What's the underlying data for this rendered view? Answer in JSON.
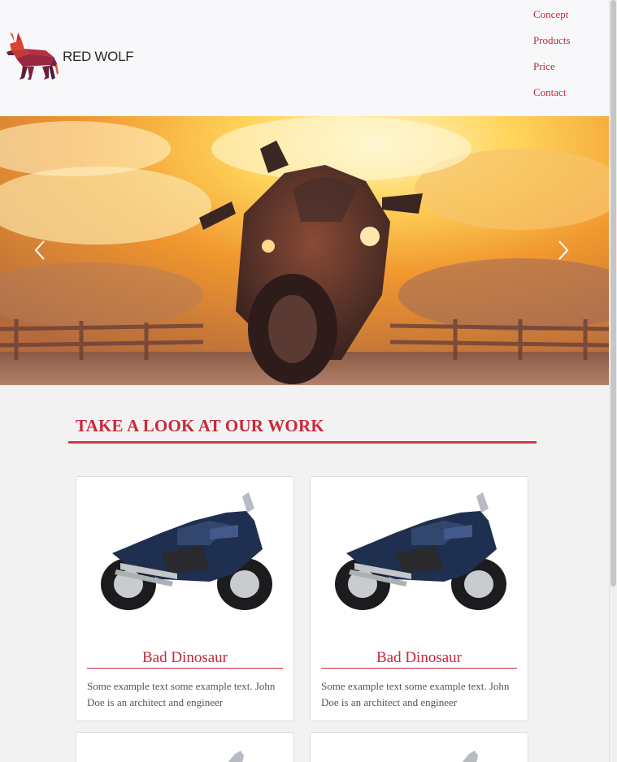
{
  "brand": {
    "name": "RED WOLF",
    "logo_icon": "wolf-logo-icon"
  },
  "nav": {
    "items": [
      {
        "label": "Concept"
      },
      {
        "label": "Products"
      },
      {
        "label": "Price"
      },
      {
        "label": "Contact"
      }
    ]
  },
  "hero": {
    "prev_icon": "chevron-left-icon",
    "next_icon": "chevron-right-icon"
  },
  "work": {
    "title": "TAKE A LOOK AT OUR WORK",
    "cards": [
      {
        "title": "Bad Dinosaur",
        "text": "Some example text some example text. John Doe is an architect and engineer"
      },
      {
        "title": "Bad Dinosaur",
        "text": "Some example text some example text. John Doe is an architect and engineer"
      }
    ]
  },
  "colors": {
    "accent": "#c9283b",
    "header_bg": "#f8f8fa",
    "page_bg": "#f2f2f2"
  }
}
